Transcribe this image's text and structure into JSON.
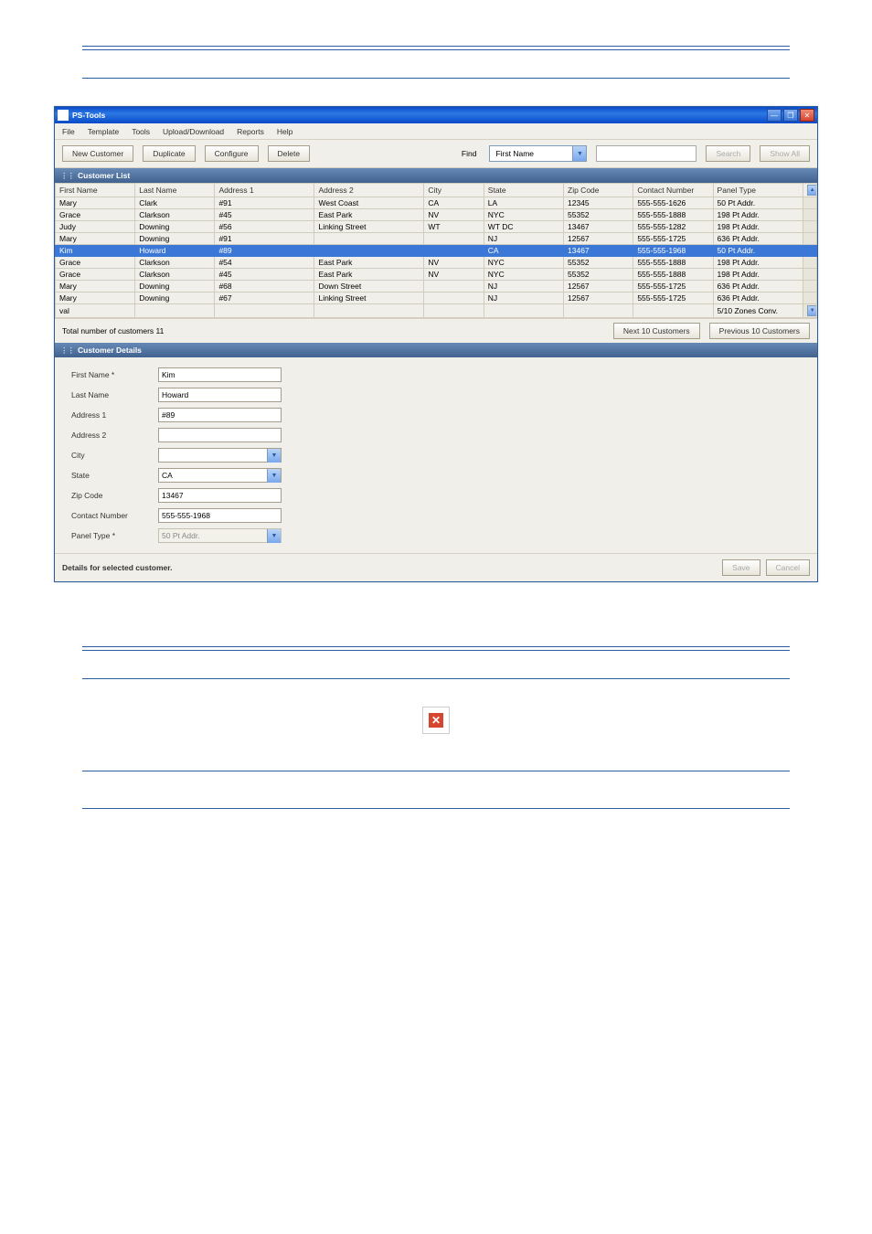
{
  "window": {
    "title": "PS-Tools"
  },
  "menubar": [
    "File",
    "Template",
    "Tools",
    "Upload/Download",
    "Reports",
    "Help"
  ],
  "toolbar": {
    "new_customer": "New Customer",
    "duplicate": "Duplicate",
    "configure": "Configure",
    "delete": "Delete",
    "find_label": "Find",
    "find_field": "First Name",
    "search": "Search",
    "show_all": "Show All"
  },
  "list_header": "Customer List",
  "columns": [
    "First Name",
    "Last Name",
    "Address 1",
    "Address 2",
    "City",
    "State",
    "Zip Code",
    "Contact Number",
    "Panel Type"
  ],
  "rows": [
    {
      "sel": false,
      "c": [
        "Mary",
        "Clark",
        "#91",
        "West Coast",
        "CA",
        "LA",
        "12345",
        "555-555-1626",
        "50 Pt Addr."
      ]
    },
    {
      "sel": false,
      "c": [
        "Grace",
        "Clarkson",
        "#45",
        "East Park",
        "NV",
        "NYC",
        "55352",
        "555-555-1888",
        "198 Pt Addr."
      ]
    },
    {
      "sel": false,
      "c": [
        "Judy",
        "Downing",
        "#56",
        "Linking Street",
        "WT",
        "WT DC",
        "13467",
        "555-555-1282",
        "198 Pt Addr."
      ]
    },
    {
      "sel": false,
      "c": [
        "Mary",
        "Downing",
        "#91",
        "",
        "",
        "NJ",
        "12567",
        "555-555-1725",
        "636 Pt Addr."
      ]
    },
    {
      "sel": true,
      "c": [
        "Kim",
        "Howard",
        "#89",
        "",
        "",
        "CA",
        "13467",
        "555-555-1968",
        "50 Pt Addr."
      ]
    },
    {
      "sel": false,
      "c": [
        "Grace",
        "Clarkson",
        "#54",
        "East Park",
        "NV",
        "NYC",
        "55352",
        "555-555-1888",
        "198 Pt Addr."
      ]
    },
    {
      "sel": false,
      "c": [
        "Grace",
        "Clarkson",
        "#45",
        "East Park",
        "NV",
        "NYC",
        "55352",
        "555-555-1888",
        "198 Pt Addr."
      ]
    },
    {
      "sel": false,
      "c": [
        "Mary",
        "Downing",
        "#68",
        "Down Street",
        "",
        "NJ",
        "12567",
        "555-555-1725",
        "636 Pt Addr."
      ]
    },
    {
      "sel": false,
      "c": [
        "Mary",
        "Downing",
        "#67",
        "Linking Street",
        "",
        "NJ",
        "12567",
        "555-555-1725",
        "636 Pt Addr."
      ]
    },
    {
      "sel": false,
      "c": [
        "val",
        "",
        "",
        "",
        "",
        "",
        "",
        "",
        "5/10 Zones Conv."
      ]
    }
  ],
  "total_label": "Total number of customers 11",
  "next_btn": "Next 10 Customers",
  "prev_btn": "Previous 10 Customers",
  "details_header": "Customer Details",
  "details": {
    "first_name_l": "First Name *",
    "first_name_v": "Kim",
    "last_name_l": "Last Name",
    "last_name_v": "Howard",
    "address1_l": "Address 1",
    "address1_v": "#89",
    "address2_l": "Address 2",
    "address2_v": "",
    "city_l": "City",
    "city_v": "",
    "state_l": "State",
    "state_v": "CA",
    "zip_l": "Zip Code",
    "zip_v": "13467",
    "contact_l": "Contact Number",
    "contact_v": "555-555-1968",
    "panel_l": "Panel Type *",
    "panel_v": "50 Pt Addr."
  },
  "status": "Details for selected customer.",
  "save_btn": "Save",
  "cancel_btn": "Cancel"
}
